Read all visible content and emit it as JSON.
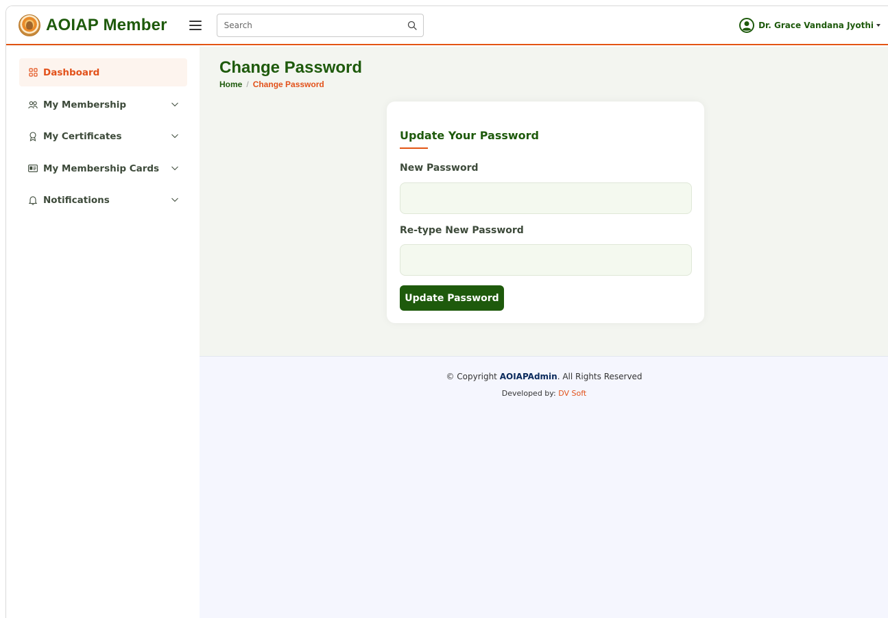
{
  "brand": {
    "title": "AOIAP Member"
  },
  "header": {
    "search_placeholder": "Search",
    "user_name": "Dr. Grace Vandana Jyothi"
  },
  "sidebar": {
    "items": [
      {
        "label": "Dashboard",
        "icon": "grid-icon",
        "active": true
      },
      {
        "label": "My Membership",
        "icon": "people-icon",
        "expandable": true
      },
      {
        "label": "My Certificates",
        "icon": "award-icon",
        "expandable": true
      },
      {
        "label": "My Membership Cards",
        "icon": "id-card-icon",
        "expandable": true
      },
      {
        "label": "Notifications",
        "icon": "bell-icon",
        "expandable": true
      }
    ]
  },
  "page": {
    "title": "Change Password",
    "breadcrumb": {
      "home": "Home",
      "separator": "/",
      "current": "Change Password"
    }
  },
  "form": {
    "title": "Update Your Password",
    "new_password_label": "New Password",
    "new_password_value": "",
    "retype_label": "Re-type New Password",
    "retype_value": "",
    "submit_label": "Update Password"
  },
  "footer": {
    "copyright_prefix": "© Copyright",
    "copyright_brand": "AOIAPAdmin",
    "copyright_suffix": ". All Rights Reserved",
    "developed_by_label": "Developed by:",
    "developer": "DV Soft"
  },
  "colors": {
    "brand_green": "#1e5a0c",
    "accent_orange": "#e25412",
    "content_bg": "#f3f5f0",
    "footer_bg": "#f5f6fe"
  }
}
